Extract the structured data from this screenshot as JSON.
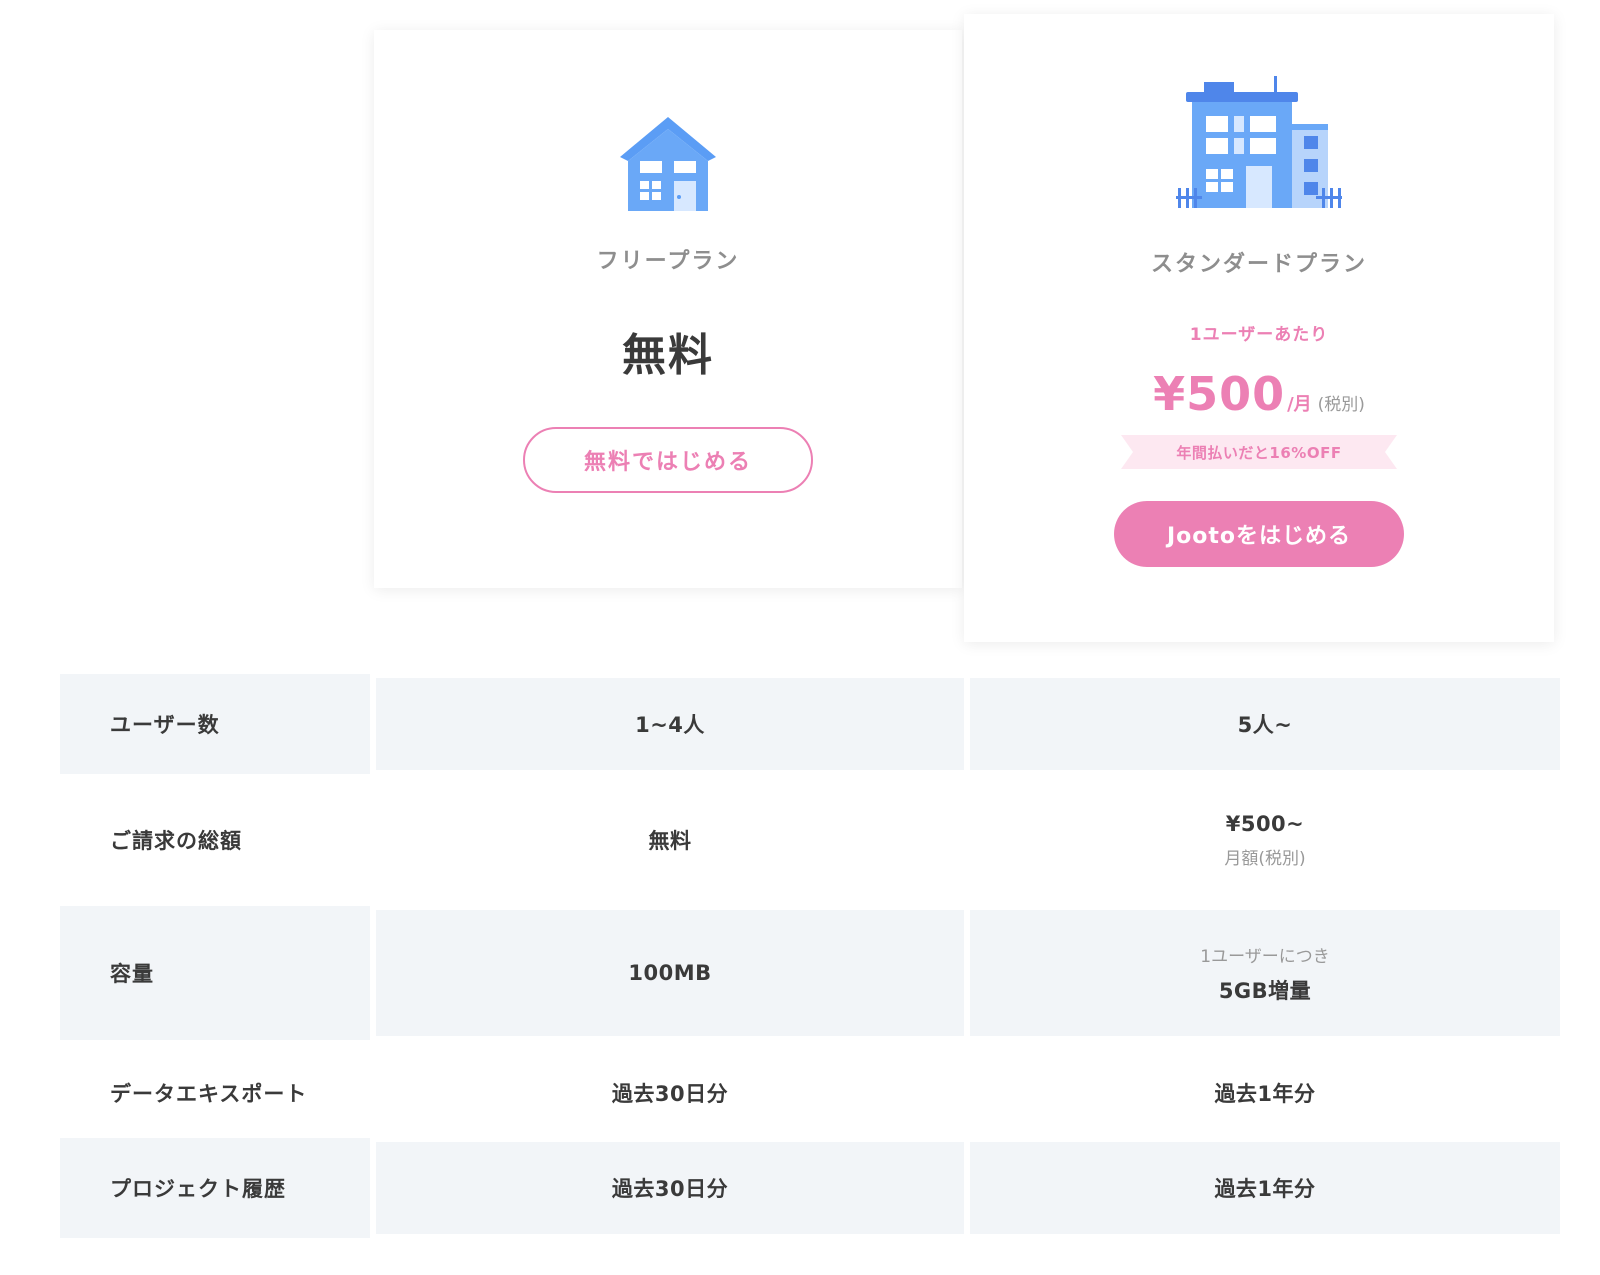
{
  "plans": {
    "free": {
      "icon": "house-icon",
      "name": "フリープラン",
      "price": "無料",
      "button_label": "無料ではじめる"
    },
    "standard": {
      "icon": "office-building-icon",
      "name": "スタンダードプラン",
      "per_user": "1ユーザーあたり",
      "price_amount": "¥500",
      "price_unit": "/月",
      "price_tax": "(税別)",
      "discount": "年間払いだと16%OFF",
      "button_label": "Jootoをはじめる"
    }
  },
  "colors": {
    "accent": "#ec80b4",
    "icon_blue": "#5b9df5",
    "row_shade": "#f2f5f8",
    "text_dark": "#3a3a3a",
    "text_muted": "#999999"
  },
  "comparison": {
    "rows": [
      {
        "label": "ユーザー数",
        "free": "1~4人",
        "std": "5人~"
      },
      {
        "label": "ご請求の総額",
        "free": "無料",
        "std": "¥500~",
        "std_sub": "月額(税別)"
      },
      {
        "label": "容量",
        "free": "100MB",
        "std_pre": "1ユーザーにつき",
        "std": "5GB増量"
      },
      {
        "label": "データエキスポート",
        "free": "過去30日分",
        "std": "過去1年分"
      },
      {
        "label": "プロジェクト履歴",
        "free": "過去30日分",
        "std": "過去1年分"
      }
    ]
  }
}
